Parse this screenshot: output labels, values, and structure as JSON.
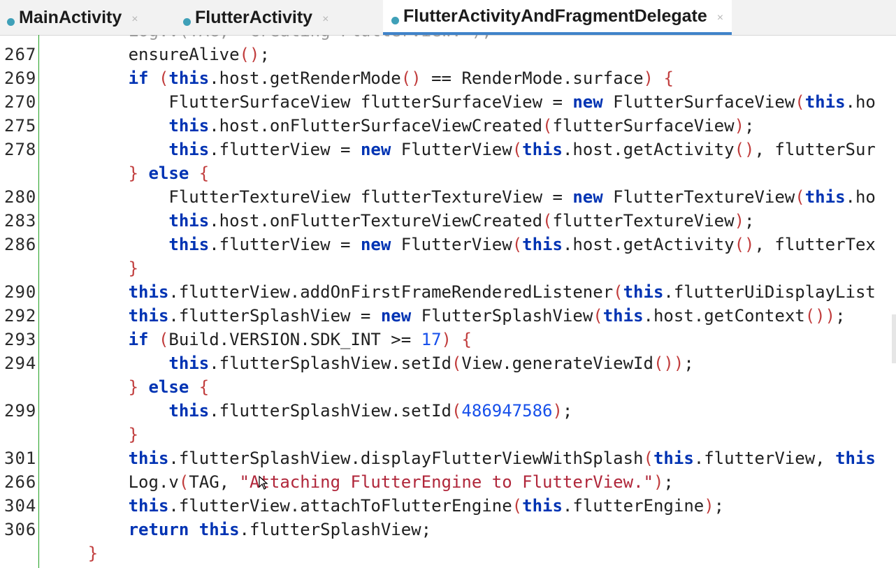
{
  "tabs": [
    {
      "label": "MainActivity",
      "active": false
    },
    {
      "label": "FlutterActivity",
      "active": false
    },
    {
      "label": "FlutterActivityAndFragmentDelegate",
      "active": true
    }
  ],
  "colors": {
    "keyword": "#0033b3",
    "string": "#b0263a",
    "bracket": "#c13d3d",
    "number": "#1750eb",
    "gutter_bar": "#22a022",
    "active_tab_underline": "#4083c9"
  },
  "icons": {
    "tab_icon": "class-icon",
    "close": "close-icon",
    "cursor": "mouse-pointer-icon"
  },
  "lines": [
    {
      "num": "",
      "segments": [
        {
          "t": "        Log.v(TAG, \"Creating FlutterView.\");",
          "c": "gray"
        }
      ]
    },
    {
      "num": "267",
      "segments": [
        {
          "t": "        ensureAlive"
        },
        {
          "t": "()",
          "c": "br"
        },
        {
          "t": ";"
        }
      ]
    },
    {
      "num": "269",
      "segments": [
        {
          "t": "        "
        },
        {
          "t": "if",
          "c": "kw"
        },
        {
          "t": " "
        },
        {
          "t": "(",
          "c": "br"
        },
        {
          "t": "this",
          "c": "kw"
        },
        {
          "t": ".host.getRenderMode"
        },
        {
          "t": "()",
          "c": "br"
        },
        {
          "t": " == RenderMode.surface"
        },
        {
          "t": ")",
          "c": "br"
        },
        {
          "t": " "
        },
        {
          "t": "{",
          "c": "br"
        }
      ]
    },
    {
      "num": "270",
      "segments": [
        {
          "t": "            FlutterSurfaceView flutterSurfaceView = "
        },
        {
          "t": "new",
          "c": "kw"
        },
        {
          "t": " FlutterSurfaceView"
        },
        {
          "t": "(",
          "c": "br"
        },
        {
          "t": "this",
          "c": "kw"
        },
        {
          "t": ".ho"
        }
      ]
    },
    {
      "num": "275",
      "segments": [
        {
          "t": "            "
        },
        {
          "t": "this",
          "c": "kw"
        },
        {
          "t": ".host.onFlutterSurfaceViewCreated"
        },
        {
          "t": "(",
          "c": "br"
        },
        {
          "t": "flutterSurfaceView"
        },
        {
          "t": ")",
          "c": "br"
        },
        {
          "t": ";"
        }
      ]
    },
    {
      "num": "278",
      "segments": [
        {
          "t": "            "
        },
        {
          "t": "this",
          "c": "kw"
        },
        {
          "t": ".flutterView = "
        },
        {
          "t": "new",
          "c": "kw"
        },
        {
          "t": " FlutterView"
        },
        {
          "t": "(",
          "c": "br"
        },
        {
          "t": "this",
          "c": "kw"
        },
        {
          "t": ".host.getActivity"
        },
        {
          "t": "()",
          "c": "br"
        },
        {
          "t": ", flutterSur"
        }
      ]
    },
    {
      "num": "",
      "segments": [
        {
          "t": "        "
        },
        {
          "t": "}",
          "c": "br"
        },
        {
          "t": " "
        },
        {
          "t": "else",
          "c": "kw"
        },
        {
          "t": " "
        },
        {
          "t": "{",
          "c": "br"
        }
      ]
    },
    {
      "num": "280",
      "segments": [
        {
          "t": "            FlutterTextureView flutterTextureView = "
        },
        {
          "t": "new",
          "c": "kw"
        },
        {
          "t": " FlutterTextureView"
        },
        {
          "t": "(",
          "c": "br"
        },
        {
          "t": "this",
          "c": "kw"
        },
        {
          "t": ".ho"
        }
      ]
    },
    {
      "num": "283",
      "segments": [
        {
          "t": "            "
        },
        {
          "t": "this",
          "c": "kw"
        },
        {
          "t": ".host.onFlutterTextureViewCreated"
        },
        {
          "t": "(",
          "c": "br"
        },
        {
          "t": "flutterTextureView"
        },
        {
          "t": ")",
          "c": "br"
        },
        {
          "t": ";"
        }
      ]
    },
    {
      "num": "286",
      "segments": [
        {
          "t": "            "
        },
        {
          "t": "this",
          "c": "kw"
        },
        {
          "t": ".flutterView = "
        },
        {
          "t": "new",
          "c": "kw"
        },
        {
          "t": " FlutterView"
        },
        {
          "t": "(",
          "c": "br"
        },
        {
          "t": "this",
          "c": "kw"
        },
        {
          "t": ".host.getActivity"
        },
        {
          "t": "()",
          "c": "br"
        },
        {
          "t": ", flutterTex"
        }
      ]
    },
    {
      "num": "",
      "segments": [
        {
          "t": "        "
        },
        {
          "t": "}",
          "c": "br"
        }
      ]
    },
    {
      "num": "290",
      "segments": [
        {
          "t": "        "
        },
        {
          "t": "this",
          "c": "kw"
        },
        {
          "t": ".flutterView.addOnFirstFrameRenderedListener"
        },
        {
          "t": "(",
          "c": "br"
        },
        {
          "t": "this",
          "c": "kw"
        },
        {
          "t": ".flutterUiDisplayList"
        }
      ]
    },
    {
      "num": "292",
      "segments": [
        {
          "t": "        "
        },
        {
          "t": "this",
          "c": "kw"
        },
        {
          "t": ".flutterSplashView = "
        },
        {
          "t": "new",
          "c": "kw"
        },
        {
          "t": " FlutterSplashView"
        },
        {
          "t": "(",
          "c": "br"
        },
        {
          "t": "this",
          "c": "kw"
        },
        {
          "t": ".host.getContext"
        },
        {
          "t": "())",
          "c": "br"
        },
        {
          "t": ";"
        }
      ]
    },
    {
      "num": "293",
      "segments": [
        {
          "t": "        "
        },
        {
          "t": "if",
          "c": "kw"
        },
        {
          "t": " "
        },
        {
          "t": "(",
          "c": "br"
        },
        {
          "t": "Build.VERSION.SDK_INT >= "
        },
        {
          "t": "17",
          "c": "num"
        },
        {
          "t": ")",
          "c": "br"
        },
        {
          "t": " "
        },
        {
          "t": "{",
          "c": "br"
        }
      ]
    },
    {
      "num": "294",
      "segments": [
        {
          "t": "            "
        },
        {
          "t": "this",
          "c": "kw"
        },
        {
          "t": ".flutterSplashView.setId"
        },
        {
          "t": "(",
          "c": "br"
        },
        {
          "t": "View.generateViewId"
        },
        {
          "t": "())",
          "c": "br"
        },
        {
          "t": ";"
        }
      ]
    },
    {
      "num": "",
      "segments": [
        {
          "t": "        "
        },
        {
          "t": "}",
          "c": "br"
        },
        {
          "t": " "
        },
        {
          "t": "else",
          "c": "kw"
        },
        {
          "t": " "
        },
        {
          "t": "{",
          "c": "br"
        }
      ]
    },
    {
      "num": "299",
      "segments": [
        {
          "t": "            "
        },
        {
          "t": "this",
          "c": "kw"
        },
        {
          "t": ".flutterSplashView.setId"
        },
        {
          "t": "(",
          "c": "br"
        },
        {
          "t": "486947586",
          "c": "num"
        },
        {
          "t": ")",
          "c": "br"
        },
        {
          "t": ";"
        }
      ]
    },
    {
      "num": "",
      "segments": [
        {
          "t": "        "
        },
        {
          "t": "}",
          "c": "br"
        }
      ]
    },
    {
      "num": "301",
      "segments": [
        {
          "t": "        "
        },
        {
          "t": "this",
          "c": "kw"
        },
        {
          "t": ".flutterSplashView.displayFlutterViewWithSplash"
        },
        {
          "t": "(",
          "c": "br"
        },
        {
          "t": "this",
          "c": "kw"
        },
        {
          "t": ".flutterView, "
        },
        {
          "t": "this",
          "c": "kw"
        }
      ]
    },
    {
      "num": "266",
      "segments": [
        {
          "t": "        Log.v"
        },
        {
          "t": "(",
          "c": "br"
        },
        {
          "t": "TAG, "
        },
        {
          "t": "\"Attaching FlutterEngine to FlutterView.\"",
          "c": "str"
        },
        {
          "t": ")",
          "c": "br"
        },
        {
          "t": ";"
        }
      ]
    },
    {
      "num": "304",
      "segments": [
        {
          "t": "        "
        },
        {
          "t": "this",
          "c": "kw"
        },
        {
          "t": ".flutterView.attachToFlutterEngine"
        },
        {
          "t": "(",
          "c": "br"
        },
        {
          "t": "this",
          "c": "kw"
        },
        {
          "t": ".flutterEngine"
        },
        {
          "t": ")",
          "c": "br"
        },
        {
          "t": ";"
        }
      ]
    },
    {
      "num": "306",
      "segments": [
        {
          "t": "        "
        },
        {
          "t": "return",
          "c": "kw"
        },
        {
          "t": " "
        },
        {
          "t": "this",
          "c": "kw"
        },
        {
          "t": ".flutterSplashView;"
        }
      ]
    },
    {
      "num": "",
      "segments": [
        {
          "t": "    "
        },
        {
          "t": "}",
          "c": "br"
        }
      ]
    }
  ]
}
